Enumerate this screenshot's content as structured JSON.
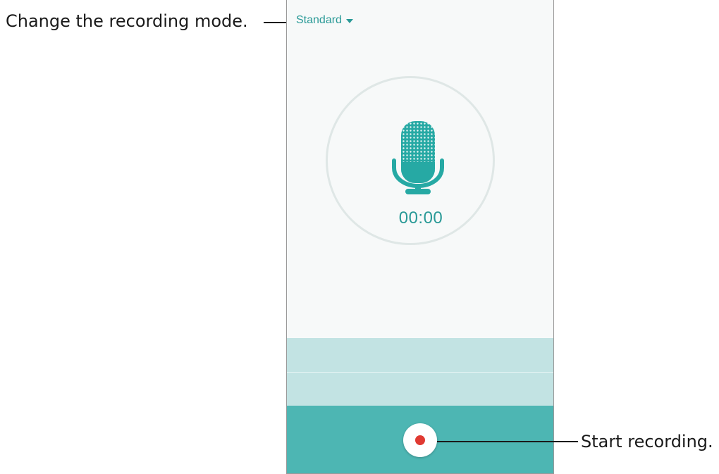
{
  "callouts": {
    "mode": "Change the recording mode.",
    "record": "Start recording."
  },
  "header": {
    "mode_label": "Standard",
    "mode_icon": "caret-down-icon"
  },
  "recorder": {
    "timer": "00:00",
    "mic_icon": "microphone-icon",
    "record_icon": "record-dot-icon"
  },
  "colors": {
    "accent": "#2a9a97",
    "control_bar": "#4db6b3",
    "wave_band": "#c2e3e3",
    "record_dot": "#e03a32"
  }
}
